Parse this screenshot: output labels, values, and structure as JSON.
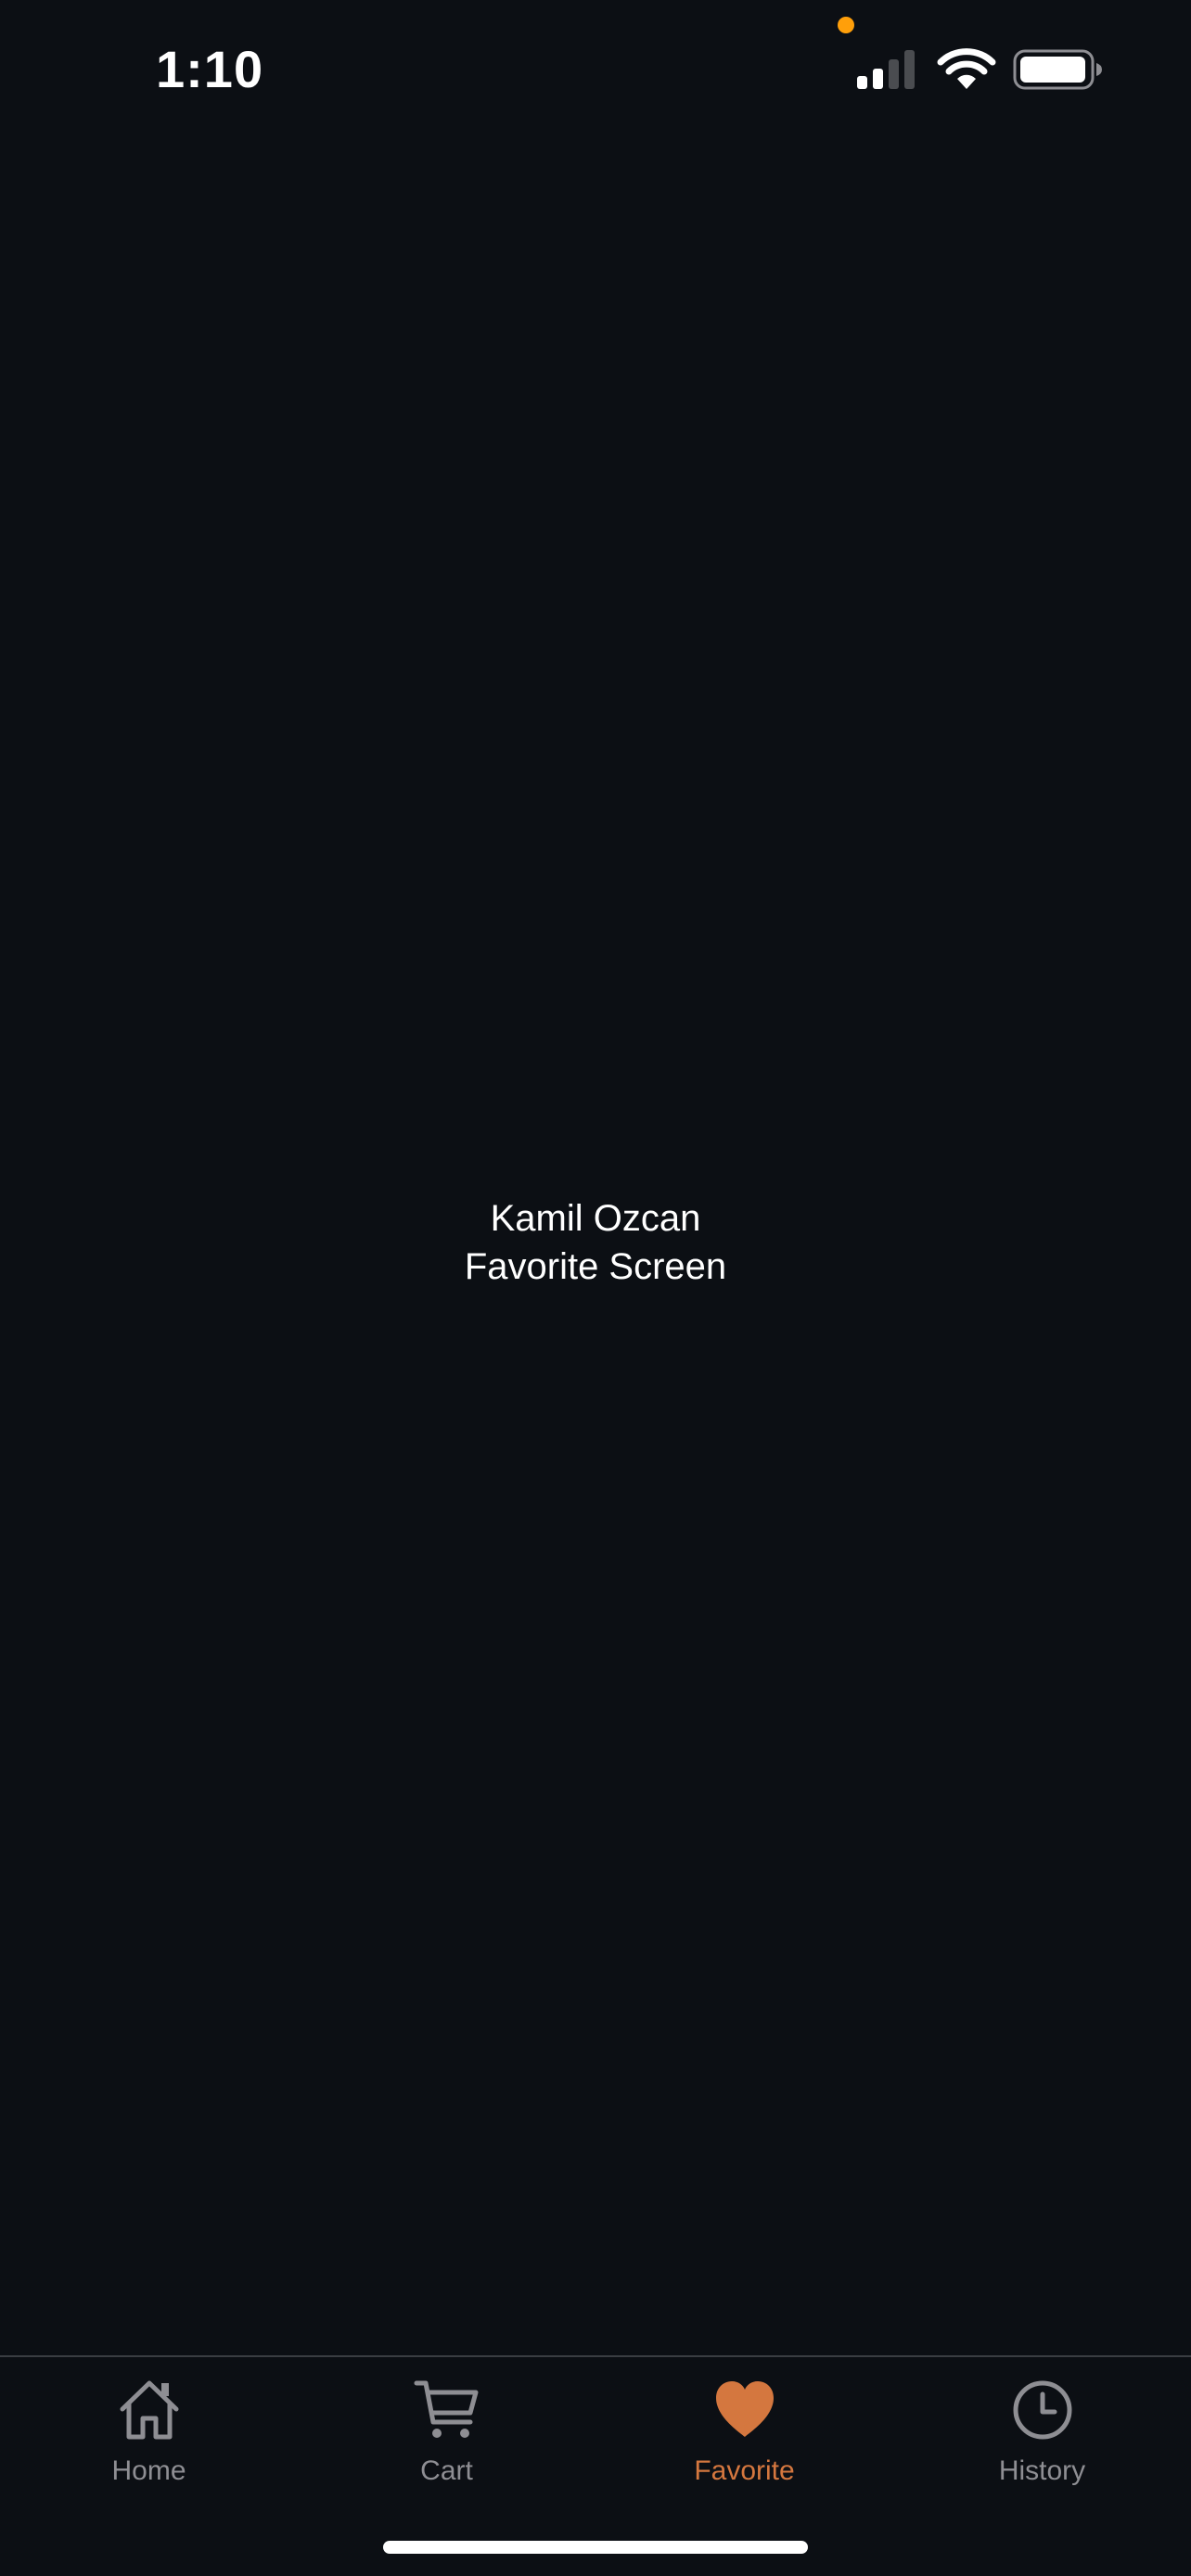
{
  "status_bar": {
    "time": "1:10",
    "icons": [
      "signal-icon",
      "wifi-icon",
      "battery-icon"
    ],
    "privacy_indicator_color": "#ff9f0a"
  },
  "main": {
    "line1": "Kamil Ozcan",
    "line2": "Favorite Screen"
  },
  "tab_bar": {
    "items": [
      {
        "label": "Home",
        "icon": "home-icon",
        "active": false
      },
      {
        "label": "Cart",
        "icon": "cart-icon",
        "active": false
      },
      {
        "label": "Favorite",
        "icon": "heart-icon",
        "active": true
      },
      {
        "label": "History",
        "icon": "clock-icon",
        "active": false
      }
    ],
    "active_color": "#d4773f",
    "inactive_color": "#8e8e93"
  },
  "colors": {
    "background": "#0c0f14",
    "text": "#ffffff"
  }
}
